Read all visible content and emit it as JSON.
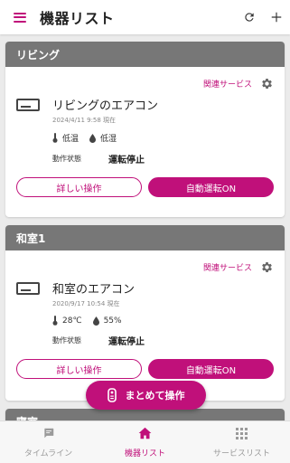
{
  "header": {
    "title": "機器リスト"
  },
  "colors": {
    "accent": "#c0107a",
    "room_header": "#777777"
  },
  "rooms": [
    {
      "name": "リビング",
      "service_link": "関連サービス",
      "device": {
        "name": "リビングのエアコン",
        "updated": "2024/4/11 9:58 現在",
        "temperature": "低温",
        "humidity": "低湿",
        "status_label": "動作状態",
        "status_value": "運転停止"
      },
      "buttons": {
        "detail": "詳しい操作",
        "auto": "自動運転ON"
      }
    },
    {
      "name": "和室1",
      "service_link": "関連サービス",
      "device": {
        "name": "和室のエアコン",
        "updated": "2020/9/17 10:54 現在",
        "temperature": "28℃",
        "humidity": "55%",
        "status_label": "動作状態",
        "status_value": "運転停止"
      },
      "buttons": {
        "detail": "詳しい操作",
        "auto": "自動運転ON"
      }
    },
    {
      "name": "寝室"
    }
  ],
  "fab": {
    "label": "まとめて操作",
    "icon": "remote-icon"
  },
  "bottom_nav": {
    "items": [
      {
        "label": "タイムライン",
        "icon": "chat-icon",
        "active": false
      },
      {
        "label": "機器リスト",
        "icon": "home-icon",
        "active": true
      },
      {
        "label": "サービスリスト",
        "icon": "grid-icon",
        "active": false
      }
    ]
  }
}
